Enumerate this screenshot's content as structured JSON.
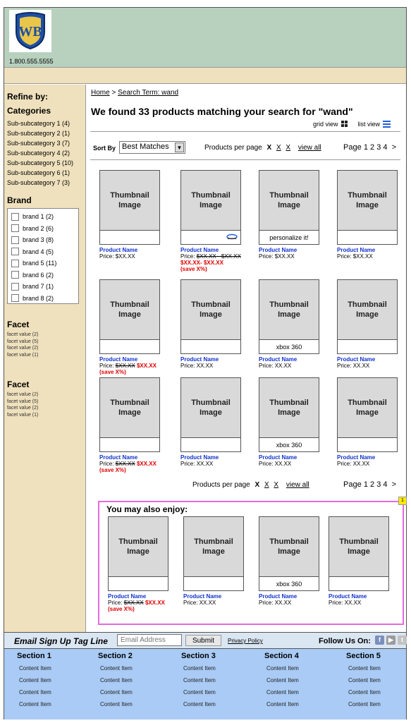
{
  "header": {
    "logo_text": "WB",
    "phone": "1.800.555.5555"
  },
  "sidebar": {
    "refine_label": "Refine by:",
    "categories_title": "Categories",
    "categories": [
      "Sub-subcategory 1 (4)",
      "Sub-subcategory 2 (1)",
      "Sub-subcategory 3 (7)",
      "Sub-subcategory 4 (2)",
      "Sub-subcategory 5 (10)",
      "Sub-subcategory 6 (1)",
      "Sub-subcategory 7 (3)"
    ],
    "brand_title": "Brand",
    "brands": [
      "brand 1 (2)",
      "brand 2 (6)",
      "brand 3 (8)",
      "brand 4 (5)",
      "brand 5 (11)",
      "brand 6 (2)",
      "brand 7 (1)",
      "brand 8 (2)"
    ],
    "facets": [
      {
        "title": "Facet",
        "values": [
          "facet value (2)",
          "facet value (5)",
          "facet value (2)",
          "facet value (1)"
        ]
      },
      {
        "title": "Facet",
        "values": [
          "facet value (2)",
          "facet value (5)",
          "facet value (2)",
          "facet value (1)"
        ]
      }
    ]
  },
  "breadcrumb": {
    "home": "Home",
    "sep": ">",
    "term": "Search Term: wand"
  },
  "results": {
    "heading": "We found 33 products matching your search  for \"wand\"",
    "grid_view": "grid view",
    "list_view": "list view",
    "sort_label": "Sort By",
    "sort_value": "Best Matches",
    "per_page_label": "Products per page",
    "per_page_current": "X",
    "per_page_options": [
      "X",
      "X"
    ],
    "view_all": "view all",
    "page_label": "Page",
    "pages": [
      "1",
      "2",
      "3",
      "4"
    ],
    "next": ">"
  },
  "products": [
    {
      "thumb": "Thumbnail Image",
      "under": "",
      "name": "Product Name",
      "price_label": "Price:",
      "price": "$XX.XX",
      "old": "",
      "sale": "",
      "save": ""
    },
    {
      "thumb": "Thumbnail Image",
      "under": "blu-ray-icon",
      "name": "Product Name",
      "price_label": "Price:",
      "price": "",
      "old": "$XX.XX - $XX.XX",
      "sale": "$XX.XX- $XX.XX",
      "save": "(save X%)"
    },
    {
      "thumb": "Thumbnail Image",
      "under": "personalize it!",
      "name": "Product Name",
      "price_label": "Price:",
      "price": "$XX.XX",
      "old": "",
      "sale": "",
      "save": ""
    },
    {
      "thumb": "Thumbnail Image",
      "under": "",
      "name": "Product Name",
      "price_label": "Price:",
      "price": "$XX.XX",
      "old": "",
      "sale": "",
      "save": ""
    },
    {
      "thumb": "Thumbnail Image",
      "under": "",
      "name": "Product Name",
      "price_label": "Price:",
      "price": "",
      "old": "$XX.XX",
      "sale": "$XX.XX",
      "save": "(save X%)"
    },
    {
      "thumb": "Thumbnail Image",
      "under": "",
      "name": "Product Name",
      "price_label": "Price:",
      "price": "XX.XX",
      "old": "",
      "sale": "",
      "save": ""
    },
    {
      "thumb": "Thumbnail Image",
      "under": "xbox 360",
      "name": "Product Name",
      "price_label": "Price:",
      "price": "XX.XX",
      "old": "",
      "sale": "",
      "save": ""
    },
    {
      "thumb": "Thumbnail Image",
      "under": "",
      "name": "Product Name",
      "price_label": "Price:",
      "price": "XX.XX",
      "old": "",
      "sale": "",
      "save": ""
    },
    {
      "thumb": "Thumbnail Image",
      "under": "",
      "name": "Product Name",
      "price_label": "Price:",
      "price": "",
      "old": "$XX.XX",
      "sale": "$XX.XX",
      "save": "(save X%)"
    },
    {
      "thumb": "Thumbnail Image",
      "under": "",
      "name": "Product Name",
      "price_label": "Price:",
      "price": "XX.XX",
      "old": "",
      "sale": "",
      "save": ""
    },
    {
      "thumb": "Thumbnail Image",
      "under": "xbox 360",
      "name": "Product Name",
      "price_label": "Price:",
      "price": "XX.XX",
      "old": "",
      "sale": "",
      "save": ""
    },
    {
      "thumb": "Thumbnail Image",
      "under": "",
      "name": "Product Name",
      "price_label": "Price:",
      "price": "XX.XX",
      "old": "",
      "sale": "",
      "save": ""
    }
  ],
  "also_enjoy": {
    "title": "You may also enjoy:",
    "note": "1",
    "items": [
      {
        "thumb": "Thumbnail Image",
        "under": "",
        "name": "Product Name",
        "price_label": "Price:",
        "price": "",
        "old": "$XX.XX",
        "sale": "$XX.XX",
        "save": "(save X%)"
      },
      {
        "thumb": "Thumbnail Image",
        "under": "",
        "name": "Product Name",
        "price_label": "Price:",
        "price": "XX.XX",
        "old": "",
        "sale": "",
        "save": ""
      },
      {
        "thumb": "Thumbnail Image",
        "under": "xbox 360",
        "name": "Product Name",
        "price_label": "Price:",
        "price": "XX.XX",
        "old": "",
        "sale": "",
        "save": ""
      },
      {
        "thumb": "Thumbnail Image",
        "under": "",
        "name": "Product Name",
        "price_label": "Price:",
        "price": "XX.XX",
        "old": "",
        "sale": "",
        "save": ""
      }
    ]
  },
  "signup": {
    "tagline": "Email Sign Up Tag Line",
    "email_placeholder": "Email Address",
    "submit": "Submit",
    "privacy": "Privacy Policy",
    "follow": "Follow Us On:",
    "social_icons": [
      "facebook-icon",
      "youtube-icon",
      "twitter-icon"
    ]
  },
  "footer": {
    "sections": [
      {
        "title": "Section 1",
        "items": [
          "Content Item",
          "Content Item",
          "Content Item",
          "Content Item"
        ]
      },
      {
        "title": "Section 2",
        "items": [
          "Content Item",
          "Content Item",
          "Content Item",
          "Content Item"
        ]
      },
      {
        "title": "Section 3",
        "items": [
          "Content Item",
          "Content Item",
          "Content Item",
          "Content Item"
        ]
      },
      {
        "title": "Section 4",
        "items": [
          "Content Item",
          "Content Item",
          "Content Item",
          "Content Item"
        ]
      },
      {
        "title": "Section 5",
        "items": [
          "Content Item",
          "Content Item",
          "Content Item",
          "Content Item"
        ]
      }
    ]
  },
  "colors": {
    "header_bg": "#b8d1be",
    "sidebar_bg": "#efe1bd",
    "product_name": "#1133cc",
    "sale_red": "#e00000",
    "enjoy_border": "#e36be0",
    "footer_bg": "#a9cbf5"
  }
}
